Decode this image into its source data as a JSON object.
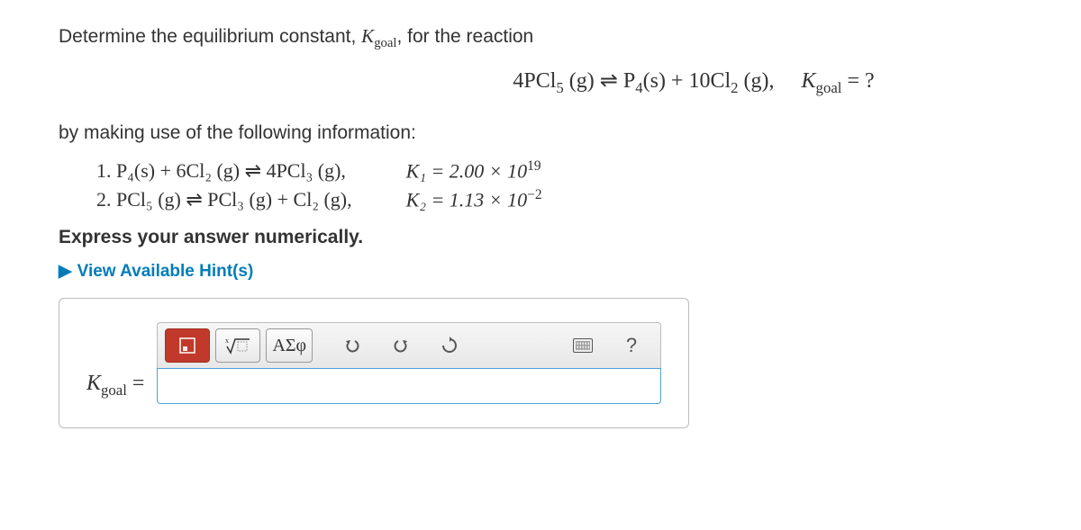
{
  "prompt": {
    "lead": "Determine the equilibrium constant, ",
    "ksym_K": "K",
    "ksym_sub": "goal",
    "tail": ", for the reaction"
  },
  "goal_equation": {
    "lhs": "4PCl",
    "lhs_sub": "5",
    "lhs_phase": " (g) ",
    "arrows": "⇌",
    "rhs_a": " P",
    "rhs_a_sub": "4",
    "rhs_a_phase": "(s) + 10Cl",
    "rhs_b_sub": "2",
    "rhs_b_phase": " (g),",
    "k_label_K": "K",
    "k_label_sub": "goal",
    "k_eq": " = ?"
  },
  "info_line": "by making use of the following information:",
  "reactions": {
    "r1": "1. P₄(s) + 6Cl₂ (g) ⇌ 4PCl₃ (g),",
    "r2": "2. PCl₅ (g) ⇌ PCl₃ (g) + Cl₂ (g),",
    "k1_lhs": "K₁ = 2.00 × 10",
    "k1_exp": "19",
    "k2_lhs": "K₂ = 1.13 × 10",
    "k2_exp": "−2"
  },
  "express": "Express your answer numerically.",
  "hints": {
    "arrow": "▶",
    "label": "View Available Hint(s)"
  },
  "toolbar": {
    "template_btn": "□",
    "root_btn": "ᵡ√□",
    "greek_btn": "ΑΣφ",
    "undo": "↶",
    "redo": "↷",
    "reset": "↻",
    "help": "?"
  },
  "answer": {
    "label_K": "K",
    "label_sub": "goal",
    "label_eq": " ="
  }
}
